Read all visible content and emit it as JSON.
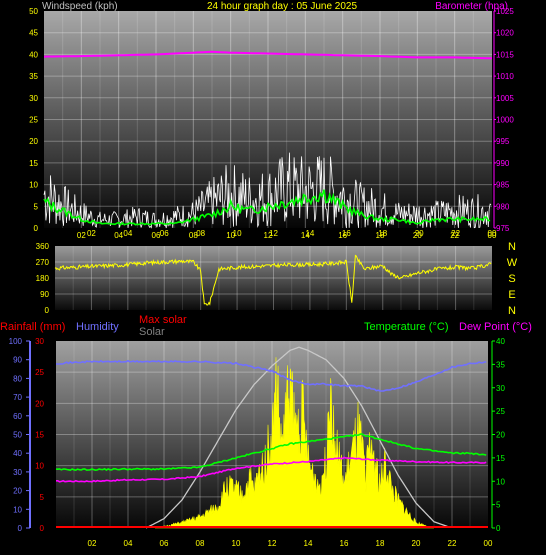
{
  "colors": {
    "wind_label": "#c0c0c0",
    "title": "#ffff00",
    "baro": "#ff00ff",
    "axis_tick": "#ffff00",
    "green": "#00ff00",
    "rain": "#ff0000",
    "humidity": "#7070ff",
    "maxsolar": "#ff0000",
    "solar": "#808080",
    "temp": "#00ff00",
    "dew": "#ff00ff",
    "dir": "#ffff00",
    "compass": "#ffff00"
  },
  "chart_data": [
    {
      "type": "line",
      "id": "wind_baro",
      "title": "24 hour graph day : 05 June 2025",
      "left_label": "Windspeed (kph)",
      "right_label": "Barometer (hpa)",
      "x_ticks": [
        "02",
        "04",
        "06",
        "08",
        "10",
        "12",
        "14",
        "16",
        "18",
        "20",
        "22",
        "00"
      ],
      "y_left_ticks": [
        "0",
        "5",
        "10",
        "15",
        "20",
        "25",
        "30",
        "35",
        "40",
        "45",
        "50"
      ],
      "y_left_lim": [
        0,
        50
      ],
      "y_right_ticks": [
        "975",
        "980",
        "985",
        "990",
        "995",
        "1000",
        "1005",
        "1010",
        "1015",
        "1020",
        "1025"
      ],
      "y_right_lim": [
        975,
        1025
      ],
      "series": [
        {
          "name": "Barometer",
          "x_hours": [
            0,
            2,
            4,
            6,
            8,
            9,
            10,
            12,
            14,
            16,
            18,
            20,
            22,
            24
          ],
          "values": [
            1014.5,
            1014.6,
            1014.8,
            1015.0,
            1015.4,
            1015.6,
            1015.4,
            1015.2,
            1015.0,
            1014.8,
            1014.6,
            1014.3,
            1014.3,
            1014.1
          ]
        },
        {
          "name": "Gust",
          "x_hours": [
            0,
            1,
            2,
            3,
            4,
            5,
            6,
            7,
            8,
            9,
            10,
            11,
            12,
            13,
            14,
            15,
            16,
            17,
            18,
            19,
            20,
            21,
            22,
            23,
            24
          ],
          "values": [
            12,
            8,
            5,
            3,
            3,
            4,
            3,
            4,
            5,
            9,
            12,
            10,
            11,
            14,
            13,
            14,
            11,
            8,
            7,
            5,
            5,
            5,
            6,
            6,
            6
          ]
        },
        {
          "name": "Average",
          "x_hours": [
            0,
            1,
            2,
            3,
            4,
            5,
            6,
            7,
            8,
            9,
            10,
            11,
            12,
            13,
            14,
            15,
            16,
            17,
            18,
            19,
            20,
            21,
            22,
            23,
            24
          ],
          "values": [
            6,
            4,
            2,
            1,
            1,
            1,
            1,
            1,
            2,
            3,
            5,
            4,
            5,
            6,
            7,
            8,
            5,
            3,
            2,
            2,
            1,
            2,
            2,
            2,
            2
          ]
        }
      ]
    },
    {
      "type": "line",
      "id": "direction",
      "x_ticks": [
        "02",
        "04",
        "06",
        "08",
        "10",
        "12",
        "14",
        "16",
        "18",
        "20",
        "22",
        "00"
      ],
      "y_ticks": [
        "0",
        "90",
        "180",
        "270",
        "360"
      ],
      "y_lim": [
        0,
        360
      ],
      "compass": [
        "N",
        "W",
        "S",
        "E",
        "N"
      ],
      "series": [
        {
          "name": "Wind direction",
          "x_hours": [
            0,
            1,
            2,
            3,
            4,
            5,
            6,
            7,
            7.6,
            8,
            8.2,
            8.5,
            9,
            10,
            11,
            12,
            13,
            14,
            15,
            16,
            16.3,
            16.5,
            17,
            17.5,
            18,
            18.5,
            19,
            20,
            21,
            22,
            23,
            24
          ],
          "values": [
            235,
            240,
            245,
            250,
            255,
            265,
            270,
            275,
            270,
            220,
            30,
            40,
            230,
            240,
            245,
            250,
            255,
            255,
            260,
            270,
            40,
            300,
            230,
            240,
            250,
            200,
            180,
            210,
            230,
            240,
            235,
            260
          ]
        }
      ]
    },
    {
      "type": "area",
      "id": "rain_temp_solar",
      "legend": {
        "rainfall": "Rainfall (mm)",
        "humidity": "Humidity",
        "max_solar": "Max solar",
        "solar": "Solar",
        "temperature": "Temperature (°C)",
        "dew_point": "Dew Point (°C)"
      },
      "x_ticks": [
        "02",
        "04",
        "06",
        "08",
        "10",
        "12",
        "14",
        "16",
        "18",
        "20",
        "22",
        "00"
      ],
      "humidity_ticks": [
        "0",
        "10",
        "20",
        "30",
        "40",
        "50",
        "60",
        "70",
        "80",
        "90",
        "100"
      ],
      "humidity_lim": [
        0,
        100
      ],
      "rain_ticks": [
        "0",
        "5",
        "10",
        "15",
        "20",
        "25",
        "30"
      ],
      "rain_lim": [
        0,
        30
      ],
      "temp_ticks": [
        "0",
        "5",
        "10",
        "15",
        "20",
        "25",
        "30",
        "35",
        "40"
      ],
      "temp_lim": [
        0,
        40
      ],
      "series": [
        {
          "name": "Humidity",
          "x_hours": [
            0,
            2,
            4,
            6,
            8,
            10,
            12,
            13,
            14,
            15,
            16,
            17,
            18,
            19,
            20,
            21,
            22,
            23,
            24
          ],
          "values": [
            88,
            89,
            89,
            89,
            89,
            88,
            84,
            79,
            77,
            77,
            76,
            76,
            73,
            75,
            78,
            82,
            86,
            88,
            89
          ]
        },
        {
          "name": "Temperature",
          "x_hours": [
            0,
            2,
            4,
            6,
            8,
            9,
            10,
            11,
            12,
            13,
            14,
            15,
            16,
            17,
            18,
            19,
            20,
            21,
            22,
            23,
            24
          ],
          "values": [
            12.5,
            12.5,
            12.6,
            12.6,
            13,
            14,
            15,
            16,
            17,
            18,
            18.5,
            19,
            19.5,
            20,
            19,
            18,
            17,
            16.5,
            16,
            16,
            15.5
          ]
        },
        {
          "name": "Dew Point",
          "x_hours": [
            0,
            2,
            4,
            6,
            8,
            10,
            12,
            14,
            16,
            18,
            20,
            22,
            24
          ],
          "values": [
            10,
            10,
            10.3,
            10.4,
            11,
            12.8,
            13.7,
            14.2,
            15,
            14.5,
            14.2,
            14,
            14
          ]
        },
        {
          "name": "Max solar",
          "x_hours": [
            5,
            6,
            7,
            8,
            9,
            10,
            11,
            12,
            13,
            13.5,
            14,
            15,
            16,
            17,
            18,
            19,
            20,
            21,
            22
          ],
          "values": [
            0,
            1.5,
            4.5,
            9,
            14,
            19,
            23,
            26,
            28.5,
            29,
            28.5,
            27,
            24,
            19.5,
            14,
            8.5,
            4,
            1,
            0
          ]
        },
        {
          "name": "Solar",
          "x_hours": [
            5.5,
            6,
            7,
            8,
            8.5,
            9,
            9.5,
            10,
            10.3,
            10.8,
            11,
            11.5,
            12,
            12.3,
            12.5,
            12.7,
            13,
            13.3,
            13.7,
            14,
            14.3,
            14.6,
            15,
            15.2,
            15.4,
            15.6,
            16,
            16.4,
            16.8,
            17.2,
            17.5,
            18,
            18.3,
            18.7,
            19,
            19.5,
            20,
            21
          ],
          "values": [
            0,
            0.3,
            1,
            2,
            3,
            4,
            8,
            7,
            6,
            9,
            7,
            12,
            17,
            28,
            15,
            20,
            27,
            18,
            22,
            12,
            10,
            8,
            12,
            30,
            20,
            15,
            8,
            13,
            18,
            10,
            16,
            8,
            12,
            7,
            5,
            3,
            1,
            0
          ]
        },
        {
          "name": "Rainfall",
          "x_hours": [
            0,
            24
          ],
          "values": [
            0,
            0
          ]
        }
      ]
    }
  ]
}
